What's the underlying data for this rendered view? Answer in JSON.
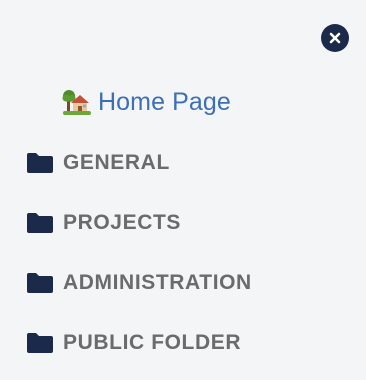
{
  "sidebar": {
    "close_icon": "close-circle-icon",
    "home": {
      "icon": "house-with-garden-icon",
      "label": "Home Page"
    },
    "folders": [
      {
        "icon": "folder-icon",
        "label": "GENERAL"
      },
      {
        "icon": "folder-icon",
        "label": "PROJECTS"
      },
      {
        "icon": "folder-icon",
        "label": "ADMINISTRATION"
      },
      {
        "icon": "folder-icon",
        "label": "PUBLIC FOLDER"
      }
    ]
  },
  "colors": {
    "background": "#f4f5f7",
    "accent_navy": "#1b2a4a",
    "link_blue": "#3d6fb6",
    "folder_label_gray": "#6b6b6b"
  }
}
